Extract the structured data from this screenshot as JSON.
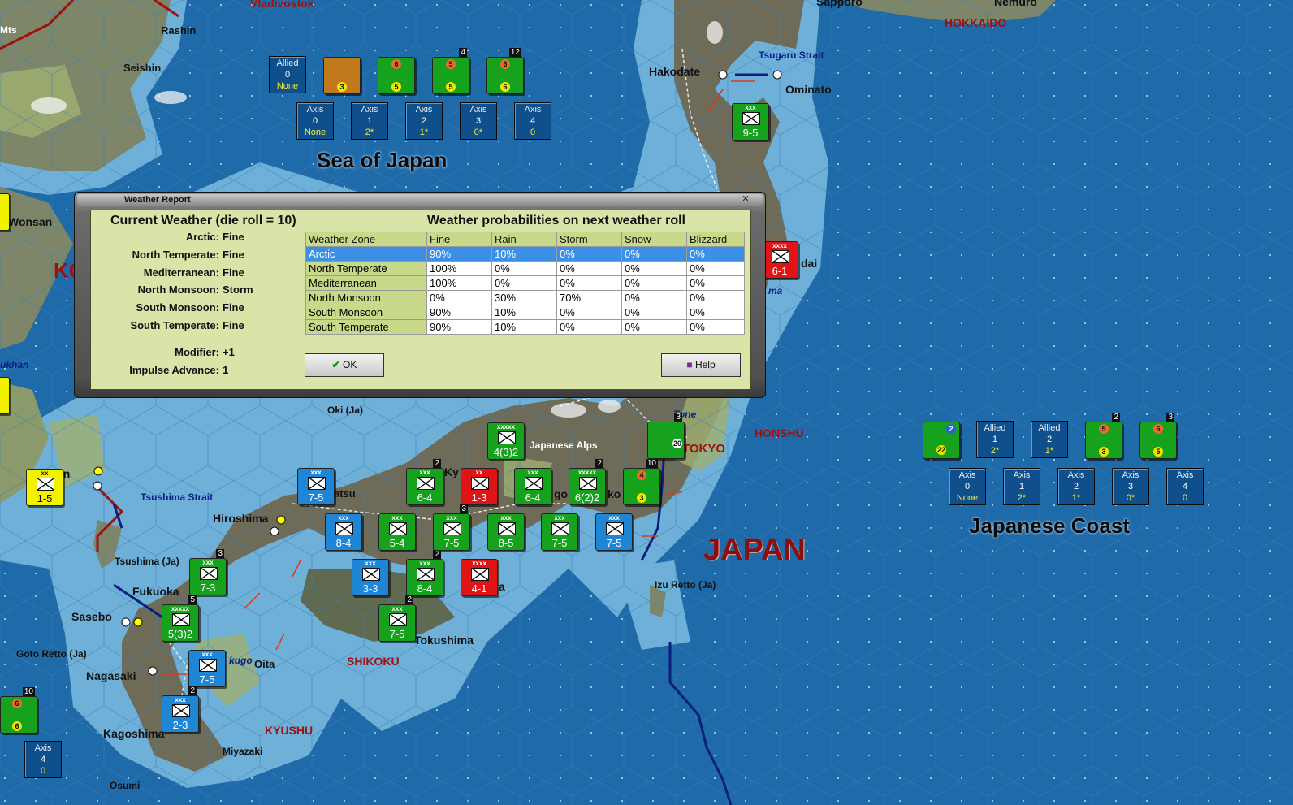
{
  "map_labels": {
    "cities": [
      "Rashin",
      "Seishin",
      "Hakodate",
      "Ominato",
      "Wonsan",
      "Hiroshima",
      "Fukuoka",
      "Sasebo",
      "Nagasaki",
      "Kagoshima",
      "Miyazaki",
      "Osumi",
      "Oita",
      "Kyushu",
      "Tokushima",
      "Oki (Ja)",
      "Tsushima (Ja)",
      "Goto Retto (Ja)",
      "Izu Retto (Ja)",
      "Sapporo",
      "Nemuro",
      "Vladivostok",
      "Mts",
      "Japanese Alps"
    ],
    "straits": [
      "Tsugaru Strait",
      "Tsushima Strait",
      "Tone",
      "ukhan",
      "kugo",
      "ma"
    ],
    "regions": [
      "HOKKAIDO",
      "HONSHU",
      "SHIKOKU",
      "KYUSHU",
      "TOKYO",
      "KO"
    ],
    "seas": [
      "Sea of Japan",
      "Japanese Coast"
    ],
    "country": "JAPAN",
    "fragments": [
      "dai",
      "an",
      "atsu",
      "go",
      "ko",
      "Ky",
      "a"
    ]
  },
  "sea_of_japan_pools": {
    "allied": [
      {
        "side": "Allied",
        "num": "0",
        "val": "None"
      }
    ],
    "axis": [
      {
        "side": "Axis",
        "num": "0",
        "val": "None"
      },
      {
        "side": "Axis",
        "num": "1",
        "val": "2*"
      },
      {
        "side": "Axis",
        "num": "2",
        "val": "1*"
      },
      {
        "side": "Axis",
        "num": "3",
        "val": "0*"
      },
      {
        "side": "Axis",
        "num": "4",
        "val": "0"
      }
    ]
  },
  "japanese_coast_pools": {
    "allied": [
      {
        "side": "Allied",
        "num": "1",
        "val": "2*"
      },
      {
        "side": "Allied",
        "num": "2",
        "val": "1*"
      }
    ],
    "axis": [
      {
        "side": "Axis",
        "num": "0",
        "val": "None"
      },
      {
        "side": "Axis",
        "num": "1",
        "val": "2*"
      },
      {
        "side": "Axis",
        "num": "2",
        "val": "1*"
      },
      {
        "side": "Axis",
        "num": "3",
        "val": "0*"
      },
      {
        "side": "Axis",
        "num": "4",
        "val": "0"
      }
    ]
  },
  "corner_pool": {
    "side": "Axis",
    "num": "4",
    "val": "0"
  },
  "units": [
    {
      "name": "unit-kyushu-1",
      "color": "green",
      "size": "xxx",
      "str": "7-3",
      "badge": "3"
    },
    {
      "name": "unit-sasebo",
      "color": "green",
      "size": "xxxxx",
      "str": "5(3)2",
      "badge": "5"
    },
    {
      "name": "unit-nagasaki",
      "color": "blue",
      "size": "xxx",
      "str": "7-5",
      "badge": ""
    },
    {
      "name": "unit-kagoshima",
      "color": "blue",
      "size": "xxx",
      "str": "2-3",
      "badge": "2"
    },
    {
      "name": "unit-korea-yellow",
      "color": "yellow",
      "size": "xx",
      "str": "1-5",
      "badge": ""
    },
    {
      "name": "unit-matsue",
      "color": "blue",
      "size": "xxx",
      "str": "7-5",
      "badge": ""
    },
    {
      "name": "unit-hiroshima-1",
      "color": "blue",
      "size": "xxx",
      "str": "8-4",
      "badge": ""
    },
    {
      "name": "unit-hiroshima-2",
      "color": "green",
      "size": "xxx",
      "str": "5-4",
      "badge": ""
    },
    {
      "name": "unit-shikoku-1",
      "color": "blue",
      "size": "xxx",
      "str": "3-3",
      "badge": ""
    },
    {
      "name": "unit-shikoku-2",
      "color": "green",
      "size": "xxx",
      "str": "8-4",
      "badge": "2"
    },
    {
      "name": "unit-shikoku-3",
      "color": "green",
      "size": "xxx",
      "str": "7-5",
      "badge": "2"
    },
    {
      "name": "unit-kyoto-1",
      "color": "green",
      "size": "xxx",
      "str": "6-4",
      "badge": "2"
    },
    {
      "name": "unit-kyoto-red",
      "color": "red",
      "size": "xx",
      "str": "1-3",
      "badge": ""
    },
    {
      "name": "unit-osaka-1",
      "color": "green",
      "size": "xxx",
      "str": "7-5",
      "badge": "3"
    },
    {
      "name": "unit-osaka-red",
      "color": "red",
      "size": "xxxx",
      "str": "4-1",
      "badge": ""
    },
    {
      "name": "unit-nagoya-1",
      "color": "green",
      "size": "xxx",
      "str": "6-4",
      "badge": ""
    },
    {
      "name": "unit-nagoya-2",
      "color": "green",
      "size": "xxx",
      "str": "8-5",
      "badge": ""
    },
    {
      "name": "unit-nagoya-3",
      "color": "green",
      "size": "xxxxx",
      "str": "6(2)2",
      "badge": "2"
    },
    {
      "name": "unit-tokai-1",
      "color": "green",
      "size": "xxx",
      "str": "7-5",
      "badge": ""
    },
    {
      "name": "unit-tokai-2",
      "color": "blue",
      "size": "xxx",
      "str": "7-5",
      "badge": ""
    },
    {
      "name": "unit-alps",
      "color": "green",
      "size": "xxxxx",
      "str": "4(3)2",
      "badge": ""
    },
    {
      "name": "unit-sendai",
      "color": "red",
      "size": "xxxx",
      "str": "6-1",
      "badge": ""
    },
    {
      "name": "unit-ominato",
      "color": "green",
      "size": "xxx",
      "str": "9-5",
      "badge": ""
    }
  ],
  "dialog": {
    "title": "Weather Report",
    "current_heading": "Current Weather (die roll = 10)",
    "prob_heading": "Weather probabilities on next weather roll",
    "current": [
      {
        "zone": "Arctic:",
        "value": "Fine"
      },
      {
        "zone": "North Temperate:",
        "value": "Fine"
      },
      {
        "zone": "Mediterranean:",
        "value": "Fine"
      },
      {
        "zone": "North Monsoon:",
        "value": "Storm"
      },
      {
        "zone": "South Monsoon:",
        "value": "Fine"
      },
      {
        "zone": "South Temperate:",
        "value": "Fine"
      }
    ],
    "modifier_label": "Modifier:",
    "modifier_value": "+1",
    "impulse_label": "Impulse Advance:",
    "impulse_value": "1",
    "table": {
      "headers": [
        "Weather Zone",
        "Fine",
        "Rain",
        "Storm",
        "Snow",
        "Blizzard"
      ],
      "rows": [
        [
          "Arctic",
          "90%",
          "10%",
          "0%",
          "0%",
          "0%"
        ],
        [
          "North Temperate",
          "100%",
          "0%",
          "0%",
          "0%",
          "0%"
        ],
        [
          "Mediterranean",
          "100%",
          "0%",
          "0%",
          "0%",
          "0%"
        ],
        [
          "North Monsoon",
          "0%",
          "30%",
          "70%",
          "0%",
          "0%"
        ],
        [
          "South Monsoon",
          "90%",
          "10%",
          "0%",
          "0%",
          "0%"
        ],
        [
          "South Temperate",
          "90%",
          "10%",
          "0%",
          "0%",
          "0%"
        ]
      ],
      "selected_row": 0
    },
    "ok_label": "OK",
    "help_label": "Help"
  }
}
